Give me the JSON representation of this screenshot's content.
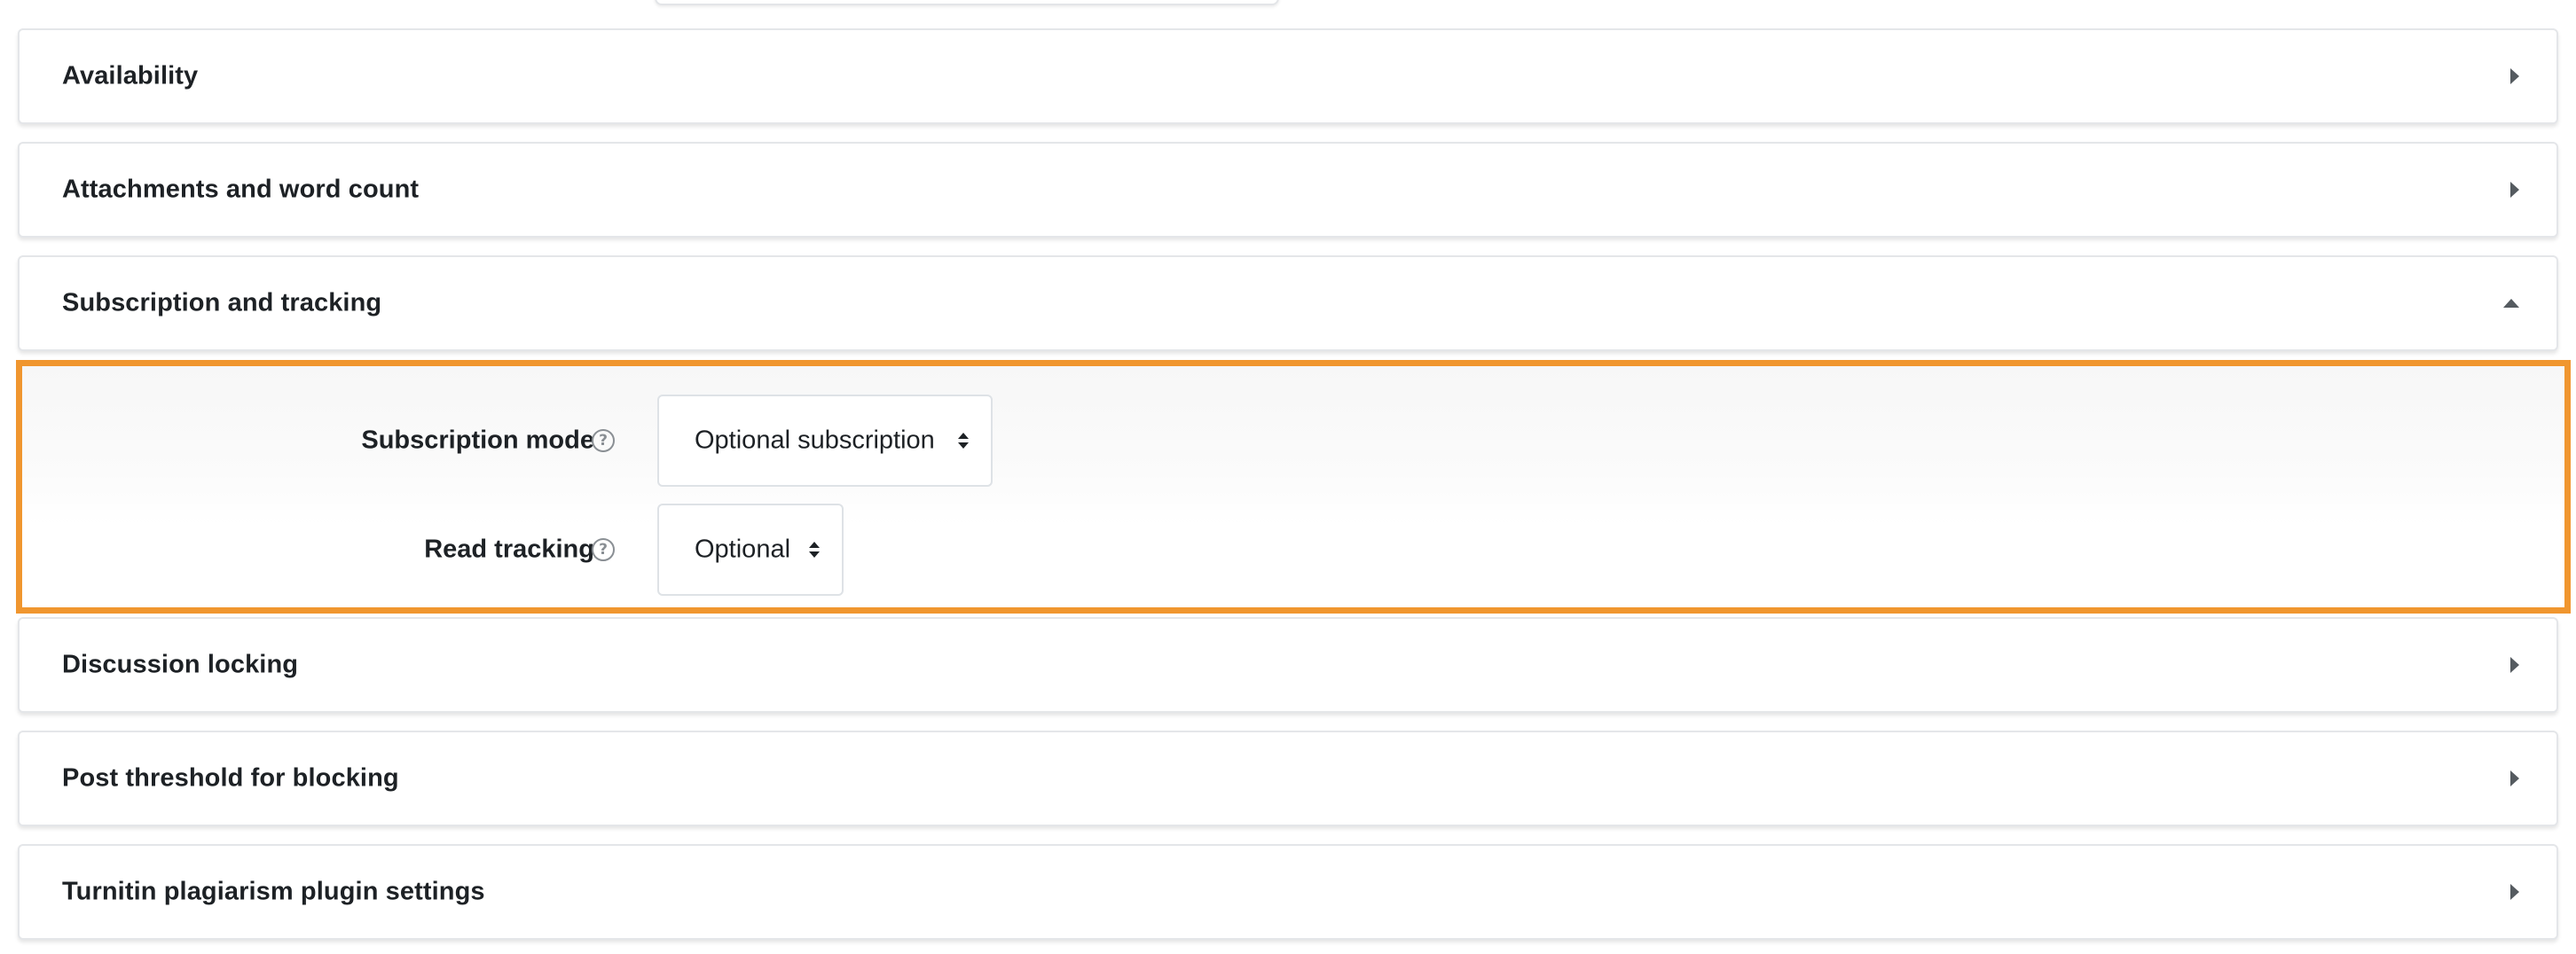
{
  "sections": {
    "availability": {
      "title": "Availability",
      "state": "collapsed"
    },
    "attachments": {
      "title": "Attachments and word count",
      "state": "collapsed"
    },
    "subscription": {
      "title": "Subscription and tracking",
      "state": "expanded"
    },
    "locking": {
      "title": "Discussion locking",
      "state": "collapsed"
    },
    "threshold": {
      "title": "Post threshold for blocking",
      "state": "collapsed"
    },
    "turnitin": {
      "title": "Turnitin plagiarism plugin settings",
      "state": "collapsed"
    }
  },
  "subscription_form": {
    "subscription_mode": {
      "label": "Subscription mode",
      "help": "?",
      "value": "Optional subscription"
    },
    "read_tracking": {
      "label": "Read tracking",
      "help": "?",
      "value": "Optional"
    }
  },
  "colors": {
    "highlight_border": "#f0962f",
    "text": "#1d2125",
    "card_border": "#e4e6e9"
  },
  "icons": {
    "collapsed": "chevron-right-icon",
    "expanded": "chevron-up-icon",
    "help": "question-circle-icon",
    "select": "sort-updown-icon"
  }
}
